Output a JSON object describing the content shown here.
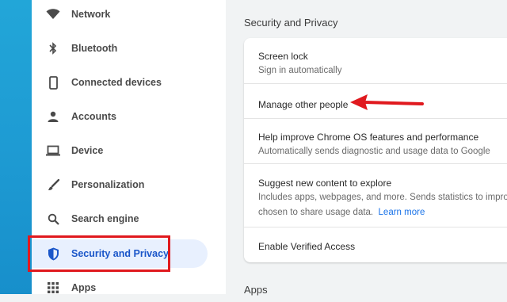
{
  "sidebar": {
    "items": [
      {
        "label": "Network",
        "icon": "wifi-icon"
      },
      {
        "label": "Bluetooth",
        "icon": "bluetooth-icon"
      },
      {
        "label": "Connected devices",
        "icon": "phone-icon"
      },
      {
        "label": "Accounts",
        "icon": "person-icon"
      },
      {
        "label": "Device",
        "icon": "laptop-icon"
      },
      {
        "label": "Personalization",
        "icon": "brush-icon"
      },
      {
        "label": "Search engine",
        "icon": "search-icon"
      },
      {
        "label": "Security and Privacy",
        "icon": "shield-icon",
        "selected": true
      },
      {
        "label": "Apps",
        "icon": "apps-grid-icon"
      }
    ]
  },
  "main": {
    "section_title": "Security and Privacy",
    "rows": [
      {
        "title": "Screen lock",
        "sub": "Sign in automatically"
      },
      {
        "title": "Manage other people"
      },
      {
        "title": "Help improve Chrome OS features and performance",
        "sub": "Automatically sends diagnostic and usage data to Google"
      },
      {
        "title": "Suggest new content to explore",
        "sub1": "Includes apps, webpages, and more. Sends statistics to impro",
        "sub2": "chosen to share usage data.",
        "link": "Learn more"
      },
      {
        "title": "Enable Verified Access"
      }
    ],
    "next_section_title": "Apps"
  },
  "colors": {
    "highlight_box": "#e0191e",
    "arrow": "#e0191e",
    "selected_text": "#1a56c9",
    "selected_bg": "#e8f0fe",
    "link": "#1a73e8"
  }
}
